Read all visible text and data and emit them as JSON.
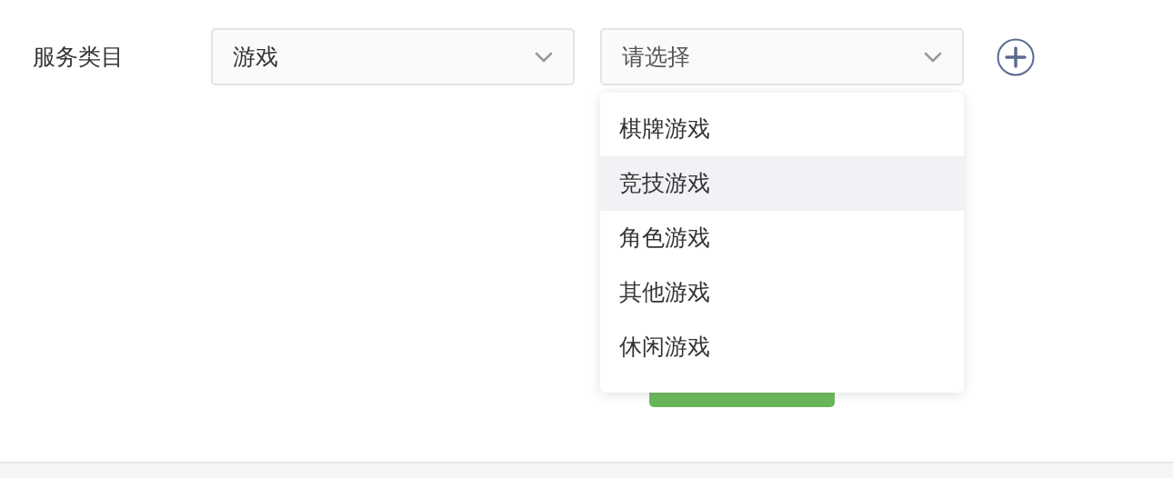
{
  "form": {
    "label": "服务类目",
    "selects": [
      {
        "value": "游戏"
      },
      {
        "placeholder": "请选择"
      }
    ]
  },
  "dropdown": {
    "options": [
      {
        "label": "棋牌游戏",
        "highlighted": false
      },
      {
        "label": "竞技游戏",
        "highlighted": true
      },
      {
        "label": "角色游戏",
        "highlighted": false
      },
      {
        "label": "其他游戏",
        "highlighted": false
      },
      {
        "label": "休闲游戏",
        "highlighted": false
      }
    ]
  }
}
